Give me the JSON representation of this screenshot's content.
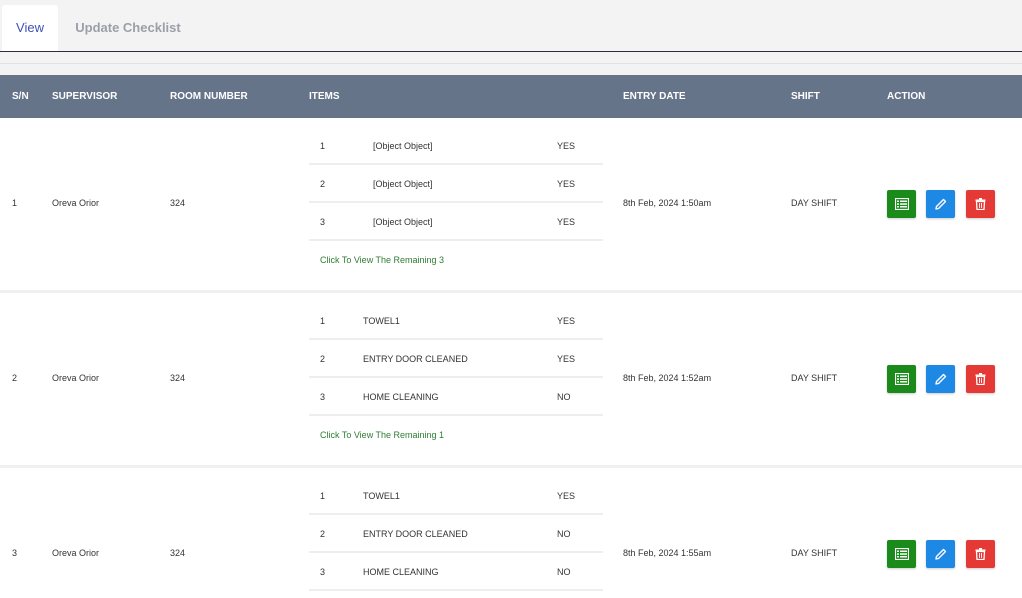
{
  "tabs": [
    {
      "label": "View"
    },
    {
      "label": "Update Checklist"
    }
  ],
  "table": {
    "headers": {
      "sn": "S/N",
      "supervisor": "SUPERVISOR",
      "room_number": "ROOM NUMBER",
      "items": "ITEMS",
      "entry_date": "ENTRY DATE",
      "shift": "SHIFT",
      "action": "ACTION"
    },
    "rows": [
      {
        "sn": "1",
        "supervisor": "Oreva Orior",
        "room_number": "324",
        "items": [
          {
            "num": "1",
            "name": "[Object Object]",
            "value": "YES"
          },
          {
            "num": "2",
            "name": "[Object Object]",
            "value": "YES"
          },
          {
            "num": "3",
            "name": "[Object Object]",
            "value": "YES"
          }
        ],
        "remaining": "Click To View The Remaining 3",
        "entry_date": "8th Feb, 2024 1:50am",
        "shift": "DAY SHIFT"
      },
      {
        "sn": "2",
        "supervisor": "Oreva Orior",
        "room_number": "324",
        "items": [
          {
            "num": "1",
            "name": "TOWEL1",
            "value": "YES"
          },
          {
            "num": "2",
            "name": "ENTRY DOOR CLEANED",
            "value": "YES"
          },
          {
            "num": "3",
            "name": "HOME CLEANING",
            "value": "NO"
          }
        ],
        "remaining": "Click To View The Remaining 1",
        "entry_date": "8th Feb, 2024 1:52am",
        "shift": "DAY SHIFT"
      },
      {
        "sn": "3",
        "supervisor": "Oreva Orior",
        "room_number": "324",
        "items": [
          {
            "num": "1",
            "name": "TOWEL1",
            "value": "YES"
          },
          {
            "num": "2",
            "name": "ENTRY DOOR CLEANED",
            "value": "NO"
          },
          {
            "num": "3",
            "name": "HOME CLEANING",
            "value": "NO"
          }
        ],
        "entry_date": "8th Feb, 2024 1:55am",
        "shift": "DAY SHIFT"
      }
    ]
  },
  "actions": {
    "view_icon": "list-icon",
    "edit_icon": "pencil-icon",
    "delete_icon": "trash-icon"
  },
  "colors": {
    "header_bg": "#66748a",
    "active_tab_text": "#3f51b5",
    "view_button": "#1a8a1a",
    "edit_button": "#1e88e5",
    "delete_button": "#e53935",
    "remaining_link": "#2e7d32"
  }
}
